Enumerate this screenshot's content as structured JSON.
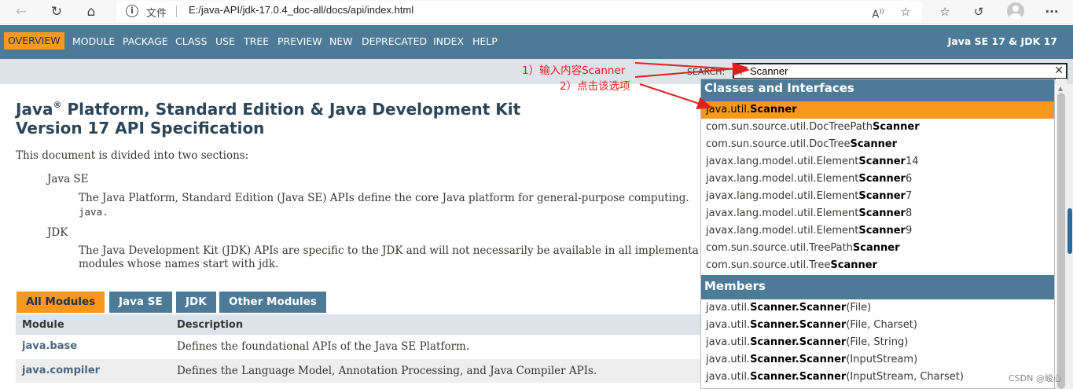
{
  "browser": {
    "back_icon": "back-arrow-icon",
    "address_label": "文件",
    "url": "E:/java-API/jdk-17.0.4_doc-all/docs/api/index.html"
  },
  "nav": {
    "items": [
      "OVERVIEW",
      "MODULE",
      "PACKAGE",
      "CLASS",
      "USE",
      "TREE",
      "PREVIEW",
      "NEW",
      "DEPRECATED",
      "INDEX",
      "HELP"
    ],
    "active": "OVERVIEW",
    "right_label": "Java SE 17 & JDK 17"
  },
  "search": {
    "label": "SEARCH:",
    "value": "Scanner"
  },
  "title": {
    "line1_a": "Java",
    "line1_sup": "®",
    "line1_b": " Platform, Standard Edition & Java Development Kit",
    "line2": "Version 17 API Specification"
  },
  "intro": "This document is divided into two sections:",
  "sections": [
    {
      "term": "Java SE",
      "desc_line1": "The Java Platform, Standard Edition (Java SE) APIs define the core Java platform for general-purpose computing.",
      "desc_line2": "java."
    },
    {
      "term": "JDK",
      "desc_line1": "The Java Development Kit (JDK) APIs are specific to the JDK and will not necessarily be available in all implementations",
      "desc_line2": "modules whose names start with jdk."
    }
  ],
  "module_tabs": [
    "All Modules",
    "Java SE",
    "JDK",
    "Other Modules"
  ],
  "table": {
    "headers": [
      "Module",
      "Description"
    ],
    "rows": [
      {
        "module": "java.base",
        "desc": "Defines the foundational APIs of the Java SE Platform."
      },
      {
        "module": "java.compiler",
        "desc": "Defines the Language Model, Annotation Processing, and Java Compiler APIs."
      }
    ]
  },
  "dropdown": {
    "category1": "Classes and Interfaces",
    "classes": [
      {
        "pre": "java.util.",
        "bold": "Scanner",
        "post": ""
      },
      {
        "pre": "com.sun.source.util.DocTreePath",
        "bold": "Scanner",
        "post": ""
      },
      {
        "pre": "com.sun.source.util.DocTree",
        "bold": "Scanner",
        "post": ""
      },
      {
        "pre": "javax.lang.model.util.Element",
        "bold": "Scanner",
        "post": "14"
      },
      {
        "pre": "javax.lang.model.util.Element",
        "bold": "Scanner",
        "post": "6"
      },
      {
        "pre": "javax.lang.model.util.Element",
        "bold": "Scanner",
        "post": "7"
      },
      {
        "pre": "javax.lang.model.util.Element",
        "bold": "Scanner",
        "post": "8"
      },
      {
        "pre": "javax.lang.model.util.Element",
        "bold": "Scanner",
        "post": "9"
      },
      {
        "pre": "com.sun.source.util.TreePath",
        "bold": "Scanner",
        "post": ""
      },
      {
        "pre": "com.sun.source.util.Tree",
        "bold": "Scanner",
        "post": ""
      }
    ],
    "category2": "Members",
    "members": [
      {
        "pre": "java.util.",
        "bold": "Scanner.Scanner",
        "post": "(File)"
      },
      {
        "pre": "java.util.",
        "bold": "Scanner.Scanner",
        "post": "(File, Charset)"
      },
      {
        "pre": "java.util.",
        "bold": "Scanner.Scanner",
        "post": "(File, String)"
      },
      {
        "pre": "java.util.",
        "bold": "Scanner.Scanner",
        "post": "(InputStream)"
      },
      {
        "pre": "java.util.",
        "bold": "Scanner.Scanner",
        "post": "(InputStream, Charset)"
      }
    ]
  },
  "annotations": {
    "step1": "1）输入内容Scanner",
    "step2": "2）点击该选项",
    "color": "#e02020"
  },
  "watermark": "CSDN @峻心"
}
